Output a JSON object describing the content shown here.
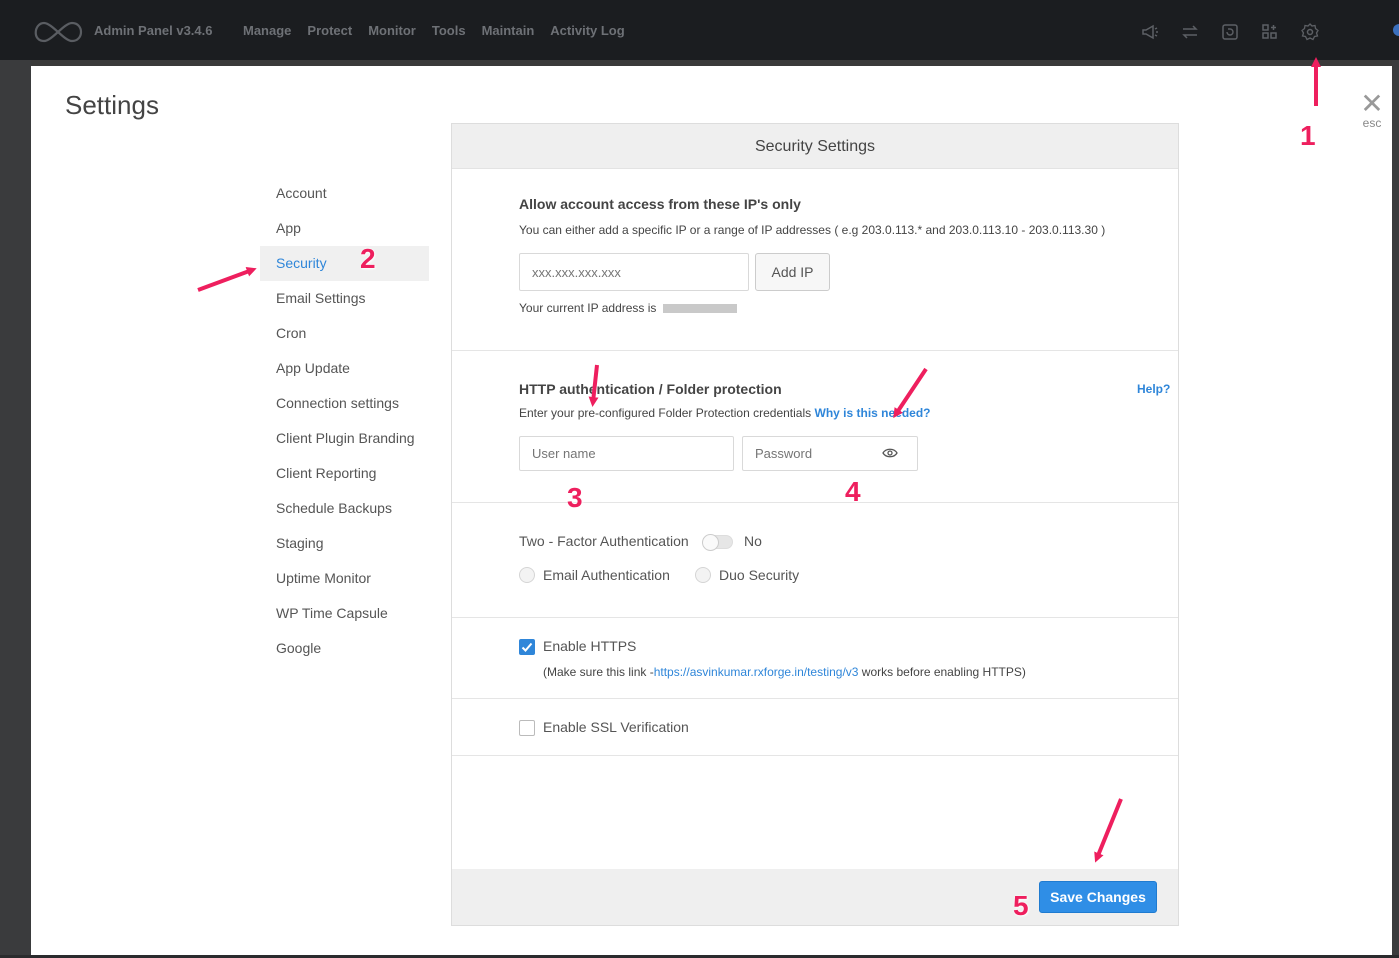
{
  "topbar": {
    "brand": "Admin Panel v3.4.6",
    "nav": [
      "Manage",
      "Protect",
      "Monitor",
      "Tools",
      "Maintain",
      "Activity Log"
    ],
    "icons": [
      "megaphone-icon",
      "sync-icon",
      "refresh-box-icon",
      "apps-icon",
      "gear-icon"
    ]
  },
  "modal": {
    "title": "Settings",
    "close_symbol": "✕",
    "close_hint": "esc"
  },
  "sidebar": {
    "items": [
      {
        "label": "Account"
      },
      {
        "label": "App"
      },
      {
        "label": "Security"
      },
      {
        "label": "Email Settings"
      },
      {
        "label": "Cron"
      },
      {
        "label": "App Update"
      },
      {
        "label": "Connection settings"
      },
      {
        "label": "Client Plugin Branding"
      },
      {
        "label": "Client Reporting"
      },
      {
        "label": "Schedule Backups"
      },
      {
        "label": "Staging"
      },
      {
        "label": "Uptime Monitor"
      },
      {
        "label": "WP Time Capsule"
      },
      {
        "label": "Google"
      }
    ],
    "active": "Security"
  },
  "panel": {
    "title": "Security Settings",
    "ip": {
      "heading": "Allow account access from these IP's only",
      "description": "You can either add a specific IP or a range of IP addresses ( e.g 203.0.113.* and 203.0.113.10 - 203.0.113.30 )",
      "placeholder": "xxx.xxx.xxx.xxx",
      "add_button": "Add IP",
      "current_label": "Your current IP address is"
    },
    "http_auth": {
      "heading": "HTTP authentication / Folder protection",
      "help": "Help?",
      "description": "Enter your pre-configured Folder Protection credentials",
      "why_link": "Why is this needed?",
      "username_placeholder": "User name",
      "password_placeholder": "Password"
    },
    "two_factor": {
      "label": "Two - Factor Authentication",
      "state": "No",
      "options": [
        "Email Authentication",
        "Duo Security"
      ]
    },
    "https": {
      "label": "Enable HTTPS",
      "checked": true,
      "note_prefix": "(Make sure this link -",
      "note_link": "https://asvinkumar.rxforge.in/testing/v3",
      "note_suffix": " works before enabling HTTPS)"
    },
    "ssl": {
      "label": "Enable SSL Verification",
      "checked": false
    },
    "save_button": "Save Changes"
  },
  "annotations": [
    "1",
    "2",
    "3",
    "4",
    "5"
  ],
  "colors": {
    "accent": "#2f86d9",
    "annotation": "#ee1f5e",
    "topbar": "#1b1d20"
  }
}
